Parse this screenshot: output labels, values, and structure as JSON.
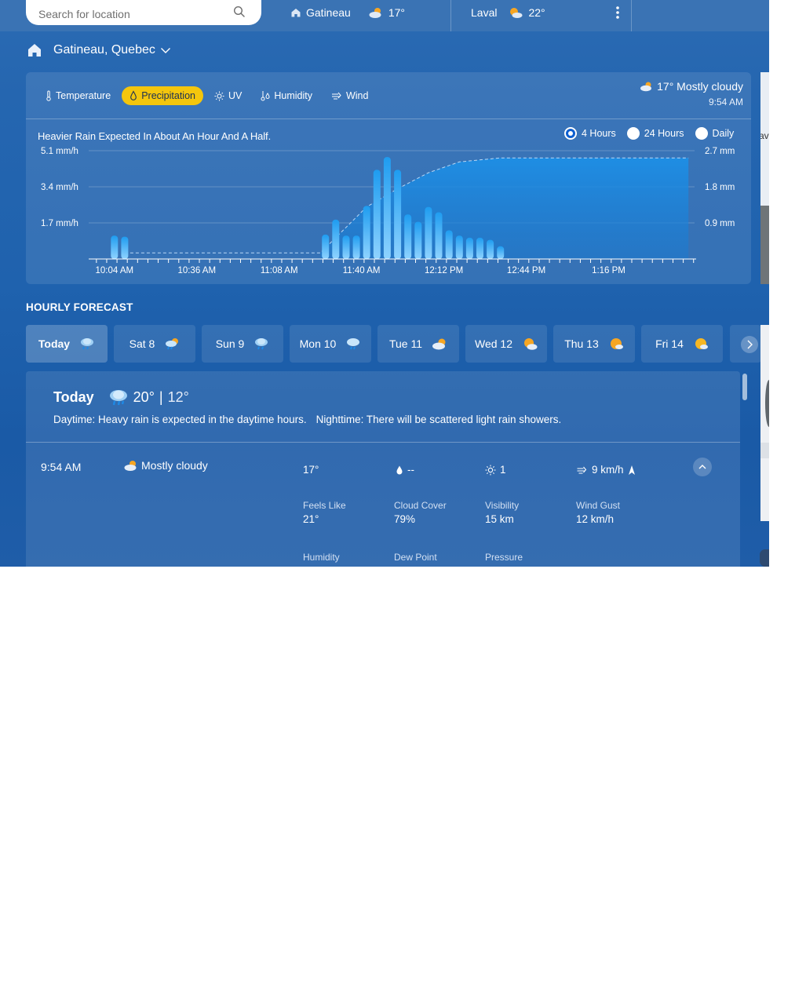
{
  "topbar": {
    "search_placeholder": "Search for location",
    "locations": [
      {
        "name": "Gatineau",
        "temp": "17°",
        "icon": "home-icon"
      },
      {
        "name": "Laval",
        "temp": "22°",
        "icon": "partly-sunny-icon"
      }
    ]
  },
  "header": {
    "location": "Gatineau, Quebec"
  },
  "tabs": [
    {
      "label": "Temperature",
      "icon": "thermometer-icon"
    },
    {
      "label": "Precipitation",
      "icon": "droplet-icon",
      "active": true
    },
    {
      "label": "UV",
      "icon": "sun-icon"
    },
    {
      "label": "Humidity",
      "icon": "humidity-icon"
    },
    {
      "label": "Wind",
      "icon": "wind-icon"
    }
  ],
  "current": {
    "condition": "17° Mostly cloudy",
    "time": "9:54 AM"
  },
  "chart": {
    "headline": "Heavier Rain Expected In About An Hour And A Half.",
    "ranges": [
      {
        "label": "4 Hours",
        "selected": true
      },
      {
        "label": "24 Hours",
        "selected": false
      },
      {
        "label": "Daily",
        "selected": false
      }
    ]
  },
  "chart_data": {
    "type": "bar",
    "title": "Heavier Rain Expected In About An Hour And A Half.",
    "x_ticks": [
      "10:04 AM",
      "10:36 AM",
      "11:08 AM",
      "11:40 AM",
      "12:12 PM",
      "12:44 PM",
      "1:16 PM"
    ],
    "y_left_ticks": [
      "5.1 mm/h",
      "3.4 mm/h",
      "1.7 mm/h"
    ],
    "y_left_values": [
      5.1,
      3.4,
      1.7
    ],
    "y_right_ticks": [
      "2.7 mm",
      "1.8 mm",
      "0.9 mm"
    ],
    "y_right_values": [
      2.7,
      1.8,
      0.9
    ],
    "ylim_left": [
      0,
      5.1
    ],
    "ylim_right": [
      0,
      2.7
    ],
    "x_minutes_range": [
      -3,
      233
    ],
    "bars_rate_mm_per_h": [
      {
        "t": 7,
        "v": 1.1
      },
      {
        "t": 11,
        "v": 1.05
      },
      {
        "t": 89,
        "v": 1.15
      },
      {
        "t": 93,
        "v": 1.85
      },
      {
        "t": 97,
        "v": 1.1
      },
      {
        "t": 101,
        "v": 1.1
      },
      {
        "t": 105,
        "v": 2.5
      },
      {
        "t": 109,
        "v": 4.2
      },
      {
        "t": 113,
        "v": 4.8
      },
      {
        "t": 117,
        "v": 4.2
      },
      {
        "t": 121,
        "v": 2.1
      },
      {
        "t": 125,
        "v": 1.75
      },
      {
        "t": 129,
        "v": 2.45
      },
      {
        "t": 133,
        "v": 2.2
      },
      {
        "t": 137,
        "v": 1.35
      },
      {
        "t": 141,
        "v": 1.1
      },
      {
        "t": 145,
        "v": 1.0
      },
      {
        "t": 149,
        "v": 1.0
      },
      {
        "t": 153,
        "v": 0.9
      },
      {
        "t": 157,
        "v": 0.6
      }
    ],
    "accumulation_mm": [
      {
        "t": 11,
        "v": 0.15
      },
      {
        "t": 87,
        "v": 0.15
      },
      {
        "t": 105,
        "v": 1.3
      },
      {
        "t": 117,
        "v": 1.75
      },
      {
        "t": 129,
        "v": 2.15
      },
      {
        "t": 141,
        "v": 2.42
      },
      {
        "t": 157,
        "v": 2.52
      },
      {
        "t": 230,
        "v": 2.52
      }
    ]
  },
  "hourly": {
    "title": "HOURLY FORECAST",
    "days": [
      {
        "label": "Today",
        "icon": "heavy-rain-icon",
        "active": true
      },
      {
        "label": "Sat 8",
        "icon": "rain-sun-icon"
      },
      {
        "label": "Sun 9",
        "icon": "heavy-rain-icon"
      },
      {
        "label": "Mon 10",
        "icon": "rain-cloud-icon"
      },
      {
        "label": "Tue 11",
        "icon": "mostly-cloudy-icon"
      },
      {
        "label": "Wed 12",
        "icon": "partly-sunny-icon"
      },
      {
        "label": "Thu 13",
        "icon": "mostly-sunny-icon"
      },
      {
        "label": "Fri 14",
        "icon": "mostly-sunny-icon"
      }
    ]
  },
  "summary": {
    "day": "Today",
    "high": "20°",
    "sep": "|",
    "low": "12°",
    "daytime": "Daytime: Heavy rain is expected in the daytime hours.",
    "nighttime": "Nighttime: There will be scattered light rain showers."
  },
  "hour": {
    "time": "9:54 AM",
    "condition": "Mostly cloudy",
    "temp": "17°",
    "precip": "--",
    "uv": "1",
    "wind": "9 km/h",
    "metrics": [
      {
        "label": "Feels Like",
        "value": "21°"
      },
      {
        "label": "Cloud Cover",
        "value": "79%"
      },
      {
        "label": "Visibility",
        "value": "15 km"
      },
      {
        "label": "Wind Gust",
        "value": "12 km/h"
      },
      {
        "label": "Humidity",
        "value": ""
      },
      {
        "label": "Dew Point",
        "value": ""
      },
      {
        "label": "Pressure",
        "value": ""
      }
    ]
  },
  "map": {
    "label": "av"
  },
  "colors": {
    "accent": "#f4c60d",
    "bar": "#1e9cf0",
    "radio": "#0d5fd0"
  }
}
